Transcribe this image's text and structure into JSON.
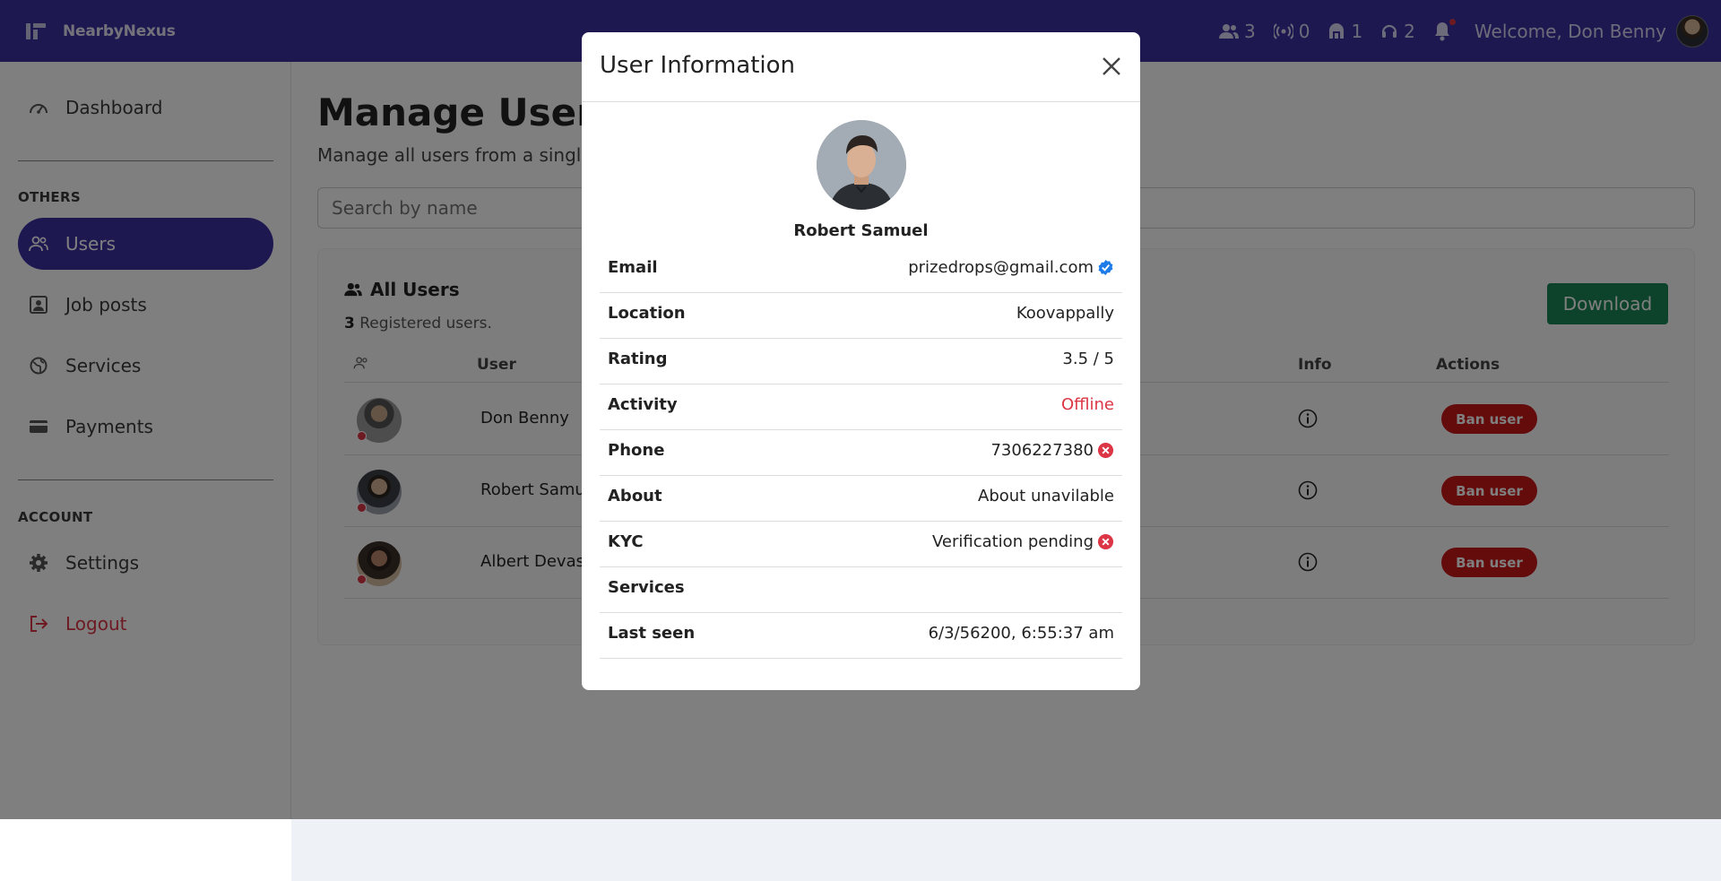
{
  "brand": {
    "name": "NearbyNexus"
  },
  "topbar": {
    "users_count": "3",
    "live_count": "0",
    "services_count": "1",
    "support_count": "2",
    "welcome": "Welcome, Don Benny"
  },
  "sidebar": {
    "dashboard": "Dashboard",
    "others_heading": "OTHERS",
    "users": "Users",
    "job_posts": "Job posts",
    "services": "Services",
    "payments": "Payments",
    "account_heading": "ACCOUNT",
    "settings": "Settings",
    "logout": "Logout"
  },
  "main": {
    "title": "Manage Users",
    "subtitle": "Manage all users from a single place",
    "search_placeholder": "Search by name",
    "card": {
      "title": "All Users",
      "count": "3",
      "count_suffix": " Registered users.",
      "download_label": "Download",
      "columns": {
        "user": "User",
        "info": "Info",
        "actions": "Actions"
      },
      "rows": [
        {
          "name": "Don Benny",
          "ban_label": "Ban user"
        },
        {
          "name": "Robert Samuel",
          "ban_label": "Ban user"
        },
        {
          "name": "Albert Devasia",
          "ban_label": "Ban user"
        }
      ]
    }
  },
  "modal": {
    "title": "User Information",
    "user_name": "Robert Samuel",
    "fields": [
      {
        "key": "Email",
        "value": "prizedrops@gmail.com",
        "icon": "verified-icon"
      },
      {
        "key": "Location",
        "value": "Koovappally"
      },
      {
        "key": "Rating",
        "value": "3.5 / 5"
      },
      {
        "key": "Activity",
        "value": "Offline"
      },
      {
        "key": "Phone",
        "value": "7306227380",
        "icon": "x-circle-icon"
      },
      {
        "key": "About",
        "value": "About unavilable"
      },
      {
        "key": "KYC",
        "value": "Verification pending",
        "icon": "x-circle-icon"
      },
      {
        "key": "Services",
        "value": ""
      },
      {
        "key": "Last seen",
        "value": "6/3/56200, 6:55:37 am"
      }
    ]
  },
  "colors": {
    "primary": "#3d30a2",
    "success": "#198754",
    "danger": "#dc3545",
    "verified": "#1e7be8"
  }
}
